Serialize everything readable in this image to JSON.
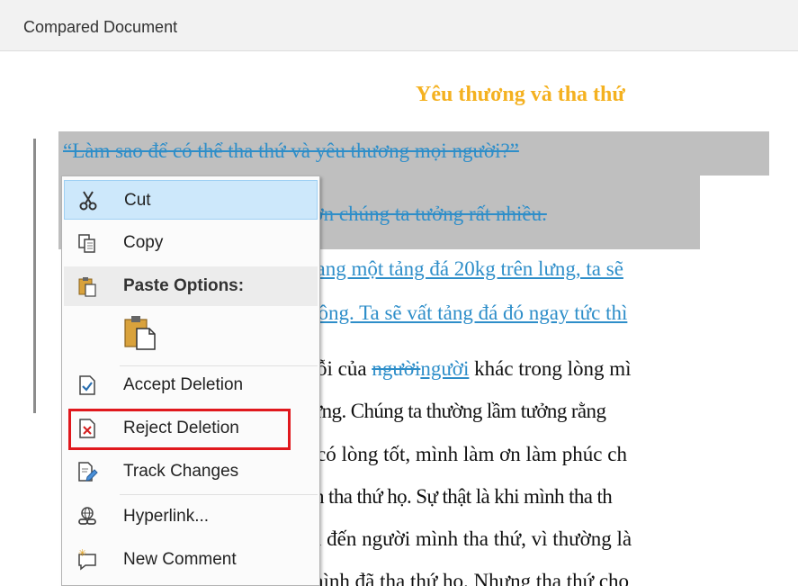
{
  "window": {
    "title": "Compared Document"
  },
  "document": {
    "title": "Yêu thương và tha thứ",
    "lines": [
      {
        "text": "“Làm sao để có thể tha thứ và yêu thương mọi người?”"
      },
      {
        "text": "hơn chúng ta tưởng rất nhiều."
      },
      {
        "text": "nang một tảng đá 20kg trên lưng, ta sẽ"
      },
      {
        "text": "hông. Ta sẽ vất tảng đá đó ngay tức thì"
      },
      {
        "before": "ỗi của ",
        "deleted": "người",
        "inserted": "người",
        "after": " khác trong lòng mì"
      },
      {
        "text": " lưng. Chúng ta thường lầm tưởng rằng"
      },
      {
        "text": "có lòng tốt, mình làm ơn làm phúc ch"
      },
      {
        "text": "h tha thứ họ. Sự thật là khi mình tha th"
      },
      {
        "text": "ì đến người mình tha thứ, vì thường là"
      },
      {
        "text": "nình đã tha thứ họ. Nhưng tha thứ cho"
      }
    ]
  },
  "context_menu": {
    "items": [
      {
        "label": "Cut",
        "icon": "scissors-icon"
      },
      {
        "label": "Copy",
        "icon": "copy-icon"
      },
      {
        "label": "Paste Options:",
        "icon": "paste-icon"
      },
      {
        "label": "Accept Deletion",
        "icon": "accept-change-icon"
      },
      {
        "label": "Reject Deletion",
        "icon": "reject-change-icon"
      },
      {
        "label": "Track Changes",
        "icon": "track-changes-icon"
      },
      {
        "label": "Hyperlink...",
        "icon": "hyperlink-icon"
      },
      {
        "label": "New Comment",
        "icon": "new-comment-icon"
      }
    ],
    "paste_option_icon": "paste-keep-text-icon",
    "hovered_item": "Cut",
    "highlighted_item": "Reject Deletion"
  },
  "colors": {
    "title": "#f4b120",
    "tracked_change": "#2e8ec9",
    "highlight_border": "#e0181d",
    "hover": "#cde8fb"
  }
}
